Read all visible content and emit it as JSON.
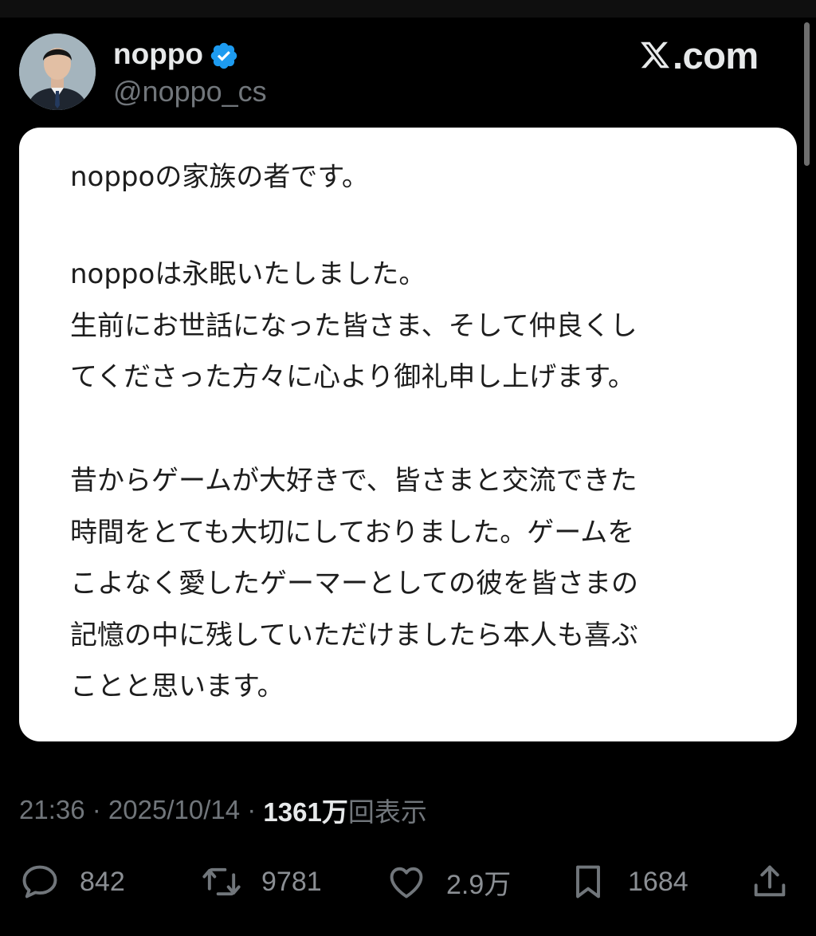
{
  "author": {
    "name": "noppo",
    "handle": "@noppo_cs",
    "verified": true,
    "avatar_icon": "avatar-photo"
  },
  "brand": {
    "logo_text": ".com",
    "logo_icon": "x-logo-icon"
  },
  "post": {
    "paragraphs": [
      "noppoの家族の者です。",
      "noppoは永眠いたしました。\n生前にお世話になった皆さま、そして仲良くし\nてくださった方々に心より御礼申し上げます。",
      "昔からゲームが大好きで、皆さまと交流できた\n時間をとても大切にしておりました。ゲームを\nこよなく愛したゲーマーとしての彼を皆さまの\n記憶の中に残していただけましたら本人も喜ぶ\nことと思います。"
    ]
  },
  "meta": {
    "time": "21:36",
    "separator": " · ",
    "date": "2025/10/14",
    "views_count": "1361万",
    "views_label": "回表示"
  },
  "actions": {
    "replies": "842",
    "reposts": "9781",
    "likes": "2.9万",
    "bookmarks": "1684"
  },
  "colors": {
    "background": "#000000",
    "card": "#ffffff",
    "muted_text": "#71767b",
    "verified_badge": "#1d9bf0"
  }
}
